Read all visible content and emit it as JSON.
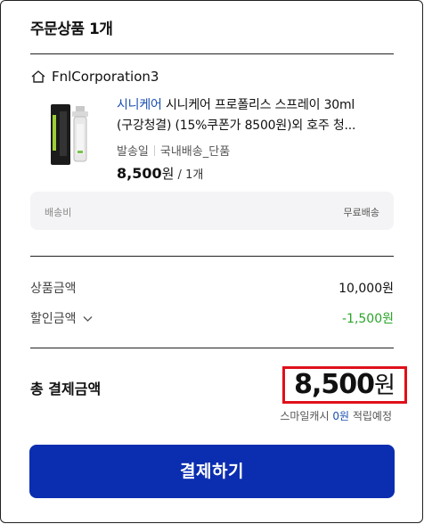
{
  "section": {
    "title": "주문상품 1개"
  },
  "seller": {
    "name": "FnlCorporation3",
    "icon": "home-icon"
  },
  "product": {
    "brand": "시니케어",
    "name_line1": " 시니케어 프로폴리스 스프레이 30ml",
    "name_line2": "(구강청결) (15%쿠폰가 8500원)외 호주 청...",
    "ship_method": "발송일",
    "ship_type": "국내배송_단품",
    "price": "8,500",
    "price_unit": "원",
    "qty": " / 1개",
    "image": "propolis-spray-thumbnail"
  },
  "shipping": {
    "label": "배송비",
    "value": "무료배송"
  },
  "summary": {
    "product_amount_label": "상품금액",
    "product_amount_value": "10,000원",
    "discount_label": "할인금액",
    "discount_value": "-1,500원"
  },
  "total": {
    "label": "총 결제금액",
    "amount": "8,500",
    "unit": "원",
    "reward_prefix": "스마일캐시 ",
    "reward_value": "0원",
    "reward_suffix": " 적립예정"
  },
  "pay_button": {
    "label": "결제하기"
  },
  "colors": {
    "brand": "#1a4fb0",
    "button": "#0b2eb0",
    "discount": "#2aa52a",
    "highlight": "#e0101a"
  }
}
